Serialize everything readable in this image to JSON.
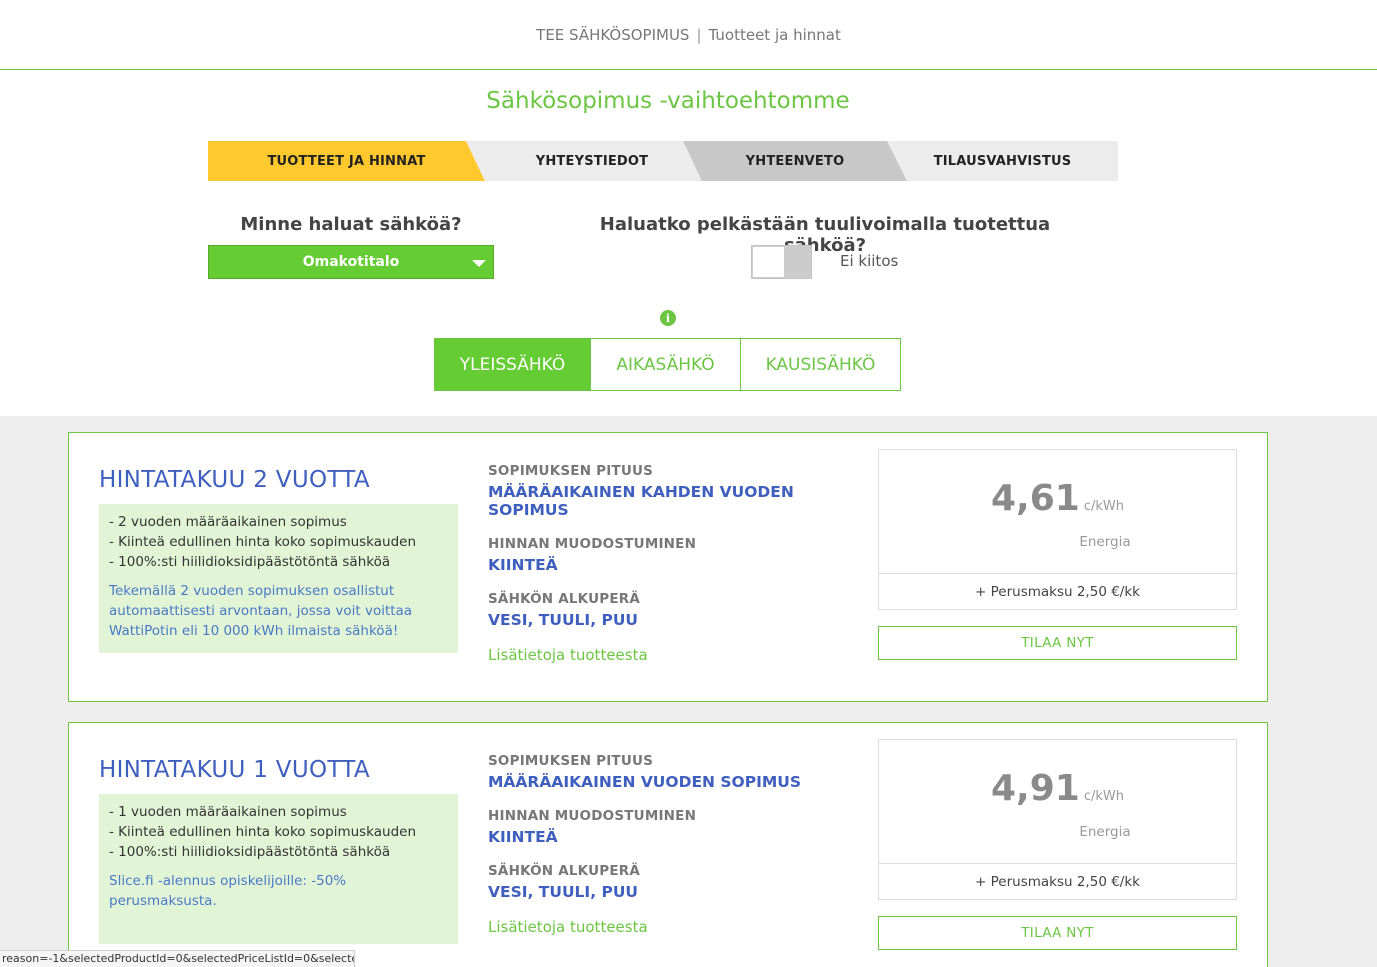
{
  "header": {
    "app_title": "TEE SÄHKÖSOPIMUS",
    "separator": "|",
    "section": "Tuotteet ja hinnat"
  },
  "page_title": "Sähkösopimus -vaihtoehtomme",
  "steps": [
    {
      "label": "TUOTTEET JA HINNAT",
      "state": "active",
      "color": "#ffc82c"
    },
    {
      "label": "YHTEYSTIEDOT",
      "state": "inactive"
    },
    {
      "label": "YHTEENVETO",
      "state": "inactive"
    },
    {
      "label": "TILAUSVAHVISTUS",
      "state": "inactive"
    }
  ],
  "location": {
    "question": "Minne haluat sähköä?",
    "selected": "Omakotitalo"
  },
  "wind": {
    "question": "Haluatko pelkästään tuulivoimalla tuotettua sähköä?",
    "toggle_on": false,
    "toggle_label": "Ei kiitos"
  },
  "info_icon": "i",
  "tariff_types": [
    {
      "label": "YLEISSÄHKÖ",
      "active": true
    },
    {
      "label": "AIKASÄHKÖ",
      "active": false
    },
    {
      "label": "KAUSISÄHKÖ",
      "active": false
    }
  ],
  "products": [
    {
      "title": "HINTATAKUU 2 VUOTTA",
      "features": [
        "- 2 vuoden määräaikainen sopimus",
        "- Kiinteä edullinen hinta koko sopimuskauden",
        "- 100%:sti hiilidioksidipäästötöntä sähköä"
      ],
      "note": "Tekemällä 2 vuoden sopimuksen osallistut automaattisesti arvontaan, jossa voit voittaa WattiPotin eli 10 000 kWh ilmaista sähköä!",
      "length_label": "SOPIMUKSEN PITUUS",
      "length_value": "MÄÄRÄAIKAINEN KAHDEN VUODEN SOPIMUS",
      "pricing_label": "HINNAN MUODOSTUMINEN",
      "pricing_value": "KIINTEÄ",
      "origin_label": "SÄHKÖN ALKUPERÄ",
      "origin_value": "VESI, TUULI, PUU",
      "more_link": "Lisätietoja tuotteesta",
      "price": "4,61",
      "unit": "c/kWh",
      "price_type": "Energia",
      "base_fee": "+ Perusmaksu 2,50 €/kk",
      "order_label": "TILAA NYT"
    },
    {
      "title": "HINTATAKUU 1 VUOTTA",
      "features": [
        "- 1 vuoden määräaikainen sopimus",
        "- Kiinteä edullinen hinta koko sopimuskauden",
        "- 100%:sti hiilidioksidipäästötöntä sähköä"
      ],
      "note": "Slice.fi -alennus opiskelijoille: -50% perusmaksusta.",
      "length_label": "SOPIMUKSEN PITUUS",
      "length_value": "MÄÄRÄAIKAINEN VUODEN SOPIMUS",
      "pricing_label": "HINNAN MUODOSTUMINEN",
      "pricing_value": "KIINTEÄ",
      "origin_label": "SÄHKÖN ALKUPERÄ",
      "origin_value": "VESI, TUULI, PUU",
      "more_link": "Lisätietoja tuotteesta",
      "price": "4,91",
      "unit": "c/kWh",
      "price_type": "Energia",
      "base_fee": "+ Perusmaksu 2,50 €/kk",
      "order_label": "TILAA NYT"
    }
  ],
  "status_url": "reason=-1&selectedProductId=0&selectedPriceListId=0&selecte...",
  "colors": {
    "brand_green": "#6cc644",
    "active_green": "#66cc33",
    "link_blue": "#3f5fbf",
    "step_active": "#ffc82c"
  }
}
